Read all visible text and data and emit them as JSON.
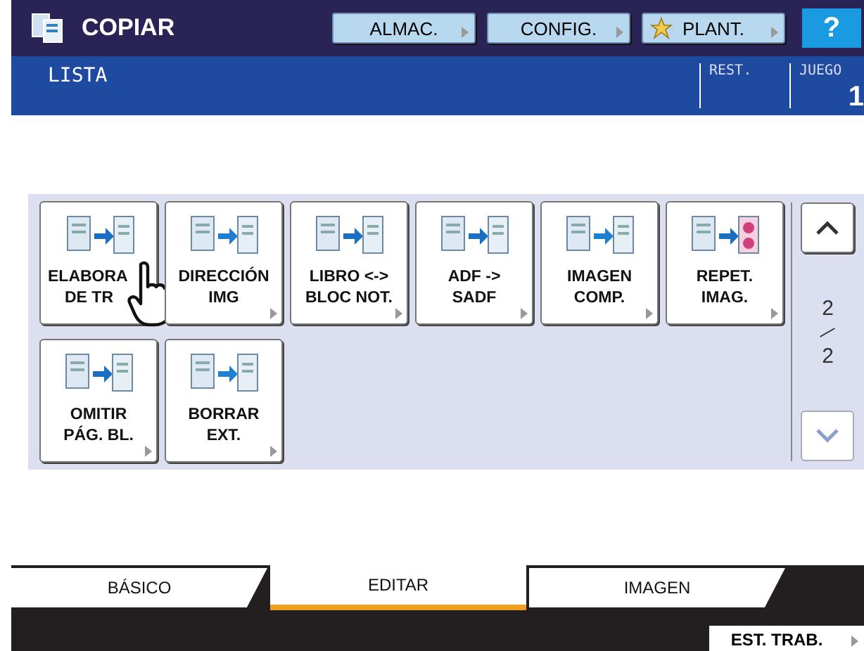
{
  "header": {
    "title": "COPIAR",
    "buttons": [
      {
        "label": "ALMAC.",
        "kind": "plain"
      },
      {
        "label": "CONFIG.",
        "kind": "plain"
      },
      {
        "label": "PLANT.",
        "kind": "star"
      }
    ],
    "help": "?"
  },
  "status": {
    "message": "LISTA",
    "rest_label": "REST.",
    "sets_label": "JUEGO",
    "sets": "1"
  },
  "functions": [
    {
      "lines": [
        "ELABORA",
        "DE TR"
      ],
      "cursor": true
    },
    {
      "lines": [
        "DIRECCIÓN",
        "IMG"
      ],
      "cursor": false
    },
    {
      "lines": [
        "LIBRO <->",
        "BLOC NOT."
      ],
      "cursor": false
    },
    {
      "lines": [
        "ADF ->",
        "SADF"
      ],
      "cursor": false
    },
    {
      "lines": [
        "IMAGEN",
        "COMP."
      ],
      "cursor": false
    },
    {
      "lines": [
        "REPET.",
        "IMAG."
      ],
      "cursor": false
    },
    {
      "lines": [
        "OMITIR",
        "PÁG. BL."
      ],
      "cursor": false
    },
    {
      "lines": [
        "BORRAR",
        "EXT."
      ],
      "cursor": false
    }
  ],
  "pager": {
    "current": "2",
    "total": "2"
  },
  "tabs": [
    {
      "label": "BÁSICO",
      "selected": false
    },
    {
      "label": "EDITAR",
      "selected": true
    },
    {
      "label": "IMAGEN",
      "selected": false
    }
  ],
  "footer_button": "EST. TRAB."
}
